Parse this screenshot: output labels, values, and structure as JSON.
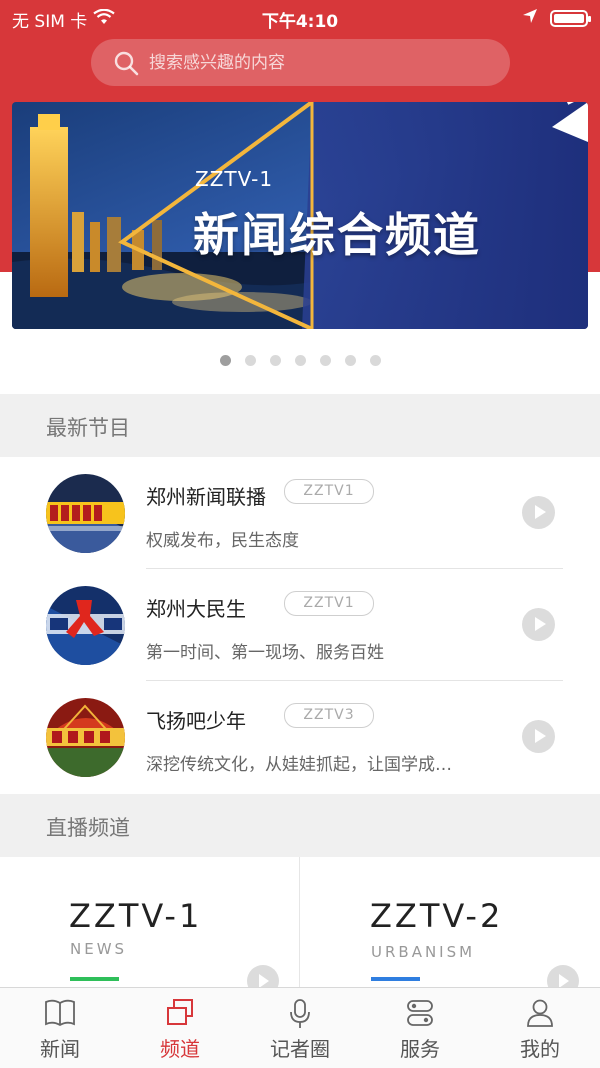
{
  "colors": {
    "brand_red": "#d7373a",
    "news_green": "#2fbf5a",
    "urban_blue": "#2f7ee0"
  },
  "status_bar": {
    "carrier": "无 SIM 卡",
    "time": "下午4:10"
  },
  "search": {
    "placeholder": "搜索感兴趣的内容"
  },
  "banner": {
    "subtitle": "ZZTV-1",
    "title": "新闻综合频道",
    "page_count": 7,
    "active_page": 1
  },
  "latest_programs": {
    "heading": "最新节目",
    "items": [
      {
        "title": "郑州新闻联播",
        "channel": "ZZTV1",
        "desc": "权威发布，民生态度",
        "thumb_icon": "zhengzhou-news-logo"
      },
      {
        "title": "郑州大民生",
        "channel": "ZZTV1",
        "desc": "第一时间、第一现场、服务百姓",
        "thumb_icon": "da-minsheng-logo"
      },
      {
        "title": "飞扬吧少年",
        "channel": "ZZTV3",
        "desc": "深挖传统文化，从娃娃抓起，让国学成…",
        "thumb_icon": "feiyang-shaonian-logo"
      }
    ]
  },
  "live_channels": {
    "heading": "直播频道",
    "items": [
      {
        "name": "ZZTV-1",
        "category": "NEWS",
        "accent": "#2fbf5a"
      },
      {
        "name": "ZZTV-2",
        "category": "URBANISM",
        "accent": "#2f7ee0"
      }
    ]
  },
  "tabbar": {
    "items": [
      {
        "label": "新闻",
        "icon": "book-icon"
      },
      {
        "label": "频道",
        "icon": "channels-icon",
        "active": true
      },
      {
        "label": "记者圈",
        "icon": "microphone-icon"
      },
      {
        "label": "服务",
        "icon": "services-icon"
      },
      {
        "label": "我的",
        "icon": "profile-icon"
      }
    ]
  }
}
